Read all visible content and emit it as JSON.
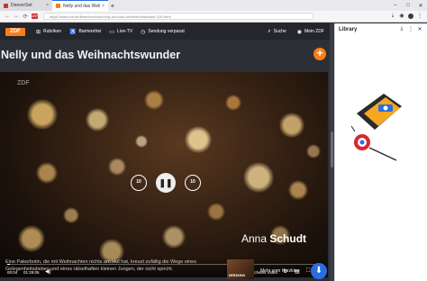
{
  "browser": {
    "tabs": [
      {
        "title": "DeeverSet",
        "favicon_color": "#c0392b"
      },
      {
        "title": "Nelly und das Weihnac",
        "favicon_color": "#fa7d19"
      }
    ],
    "url": "https://www.zdf.de/filme/herzkino/nelly-und-das-weihnachtswunder-100.html",
    "nav_back": "←",
    "nav_forward": "→",
    "nav_reload": "⟳",
    "ext_badge": "ABP"
  },
  "zdf": {
    "logo": "ZDF",
    "nav": {
      "rubriken": "Rubriken",
      "barrierefrei": "Barrierefrei",
      "live_tv": "Live-TV",
      "sendung_verpasst": "Sendung verpasst",
      "suche": "Suche",
      "mein_zdf": "Mein ZDF"
    },
    "page_title": "Nelly und das Weihnachtswunder",
    "player": {
      "watermark": "ZDF",
      "skip_back": "10",
      "skip_forward": "10",
      "overlay_first": "Anna",
      "overlay_last": "Schudt",
      "time_current": "00:04",
      "time_total": "01:29:05",
      "next_label": "nächstes Video",
      "progress": 0.01
    },
    "description": "Eine Pakerbotin, die mit Weihnachten nichts am Hut hat, kreuzt zufällig die Wege eines Gelegenheitsdiebes und eines rätselhaften kleinen Jungen, der nicht spricht.",
    "teaser": {
      "thumb_text": "HERZKINO",
      "label": "Mehr vom Herzkino"
    }
  },
  "library": {
    "title": "Library"
  },
  "colors": {
    "zdf_orange": "#fa7d19",
    "chrome_blue": "#2a6de0"
  }
}
